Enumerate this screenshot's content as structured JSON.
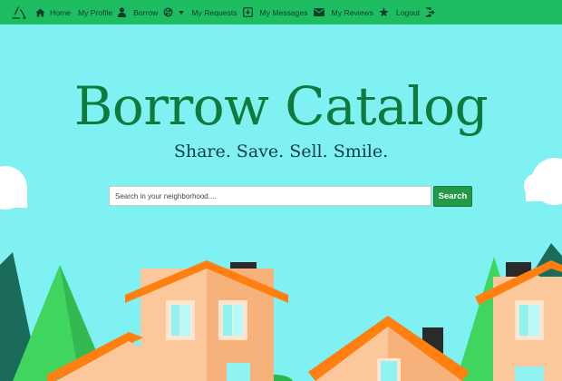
{
  "nav": {
    "brand_icon": "recycle-triangle-logo",
    "items": [
      {
        "label": "Home",
        "icon": "home-icon"
      },
      {
        "label": "My Profile",
        "icon": "user-icon"
      },
      {
        "label": "Borrow",
        "icon": "exchange-icon"
      },
      {
        "label": "My Requests",
        "icon": "download-box-icon"
      },
      {
        "label": "My Messages",
        "icon": "envelope-icon"
      },
      {
        "label": "My Reviews",
        "icon": "star-icon"
      },
      {
        "label": "Logout",
        "icon": "sign-out-icon"
      }
    ]
  },
  "hero": {
    "title": "Borrow Catalog",
    "tagline": "Share. Save. Sell. Smile."
  },
  "search": {
    "placeholder": "Search in your neighborhood....",
    "button_label": "Search"
  },
  "colors": {
    "navbar": "#1fbd61",
    "sky": "#7ff1f2",
    "title": "#0e7a3c",
    "house_wall": "#fcc89b",
    "roof": "#ff7f11",
    "tree": "#3fd55f"
  }
}
